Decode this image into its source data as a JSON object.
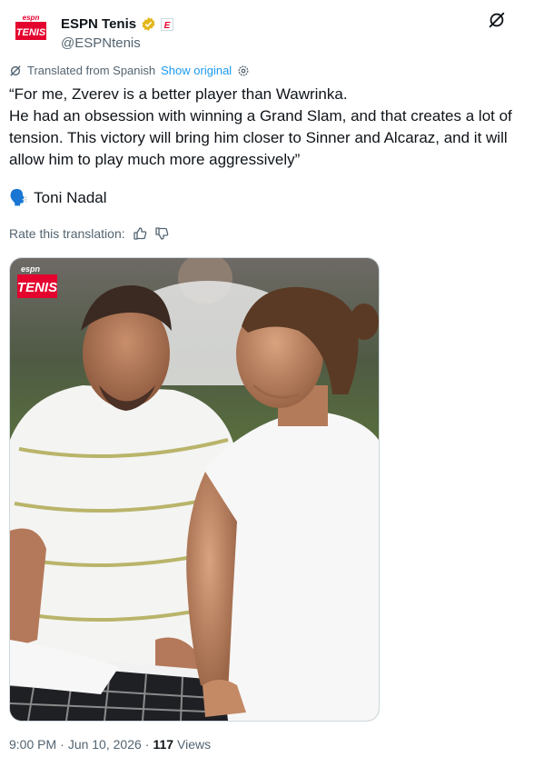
{
  "account": {
    "display_name": "ESPN Tenis",
    "handle": "@ESPNtenis",
    "avatar_text_top": "espn",
    "avatar_text_bottom": "TENIS",
    "affiliate_badge": "E"
  },
  "translation": {
    "label": "Translated from Spanish",
    "show_original": "Show original"
  },
  "tweet": {
    "line1": "“For me, Zverev is a better player than Wawrinka.",
    "line2": "He had an obsession with winning a Grand Slam, and that creates a lot of tension. This victory will bring him closer to Sinner and Alcaraz, and it will allow him to play much more aggressively”",
    "speaker_emoji": "🗣️",
    "speaker": "Toni Nadal"
  },
  "rate": {
    "label": "Rate this translation:"
  },
  "media": {
    "logo_top": "espn",
    "logo_bottom": "TENIS"
  },
  "meta": {
    "time": "9:00 PM",
    "date": "Jun 10, 2026",
    "views_count": "117",
    "views_label": "Views",
    "separator": "·"
  },
  "colors": {
    "accent": "#1d9bf0",
    "espn_red": "#e4032e",
    "gold_badge": "#e2b719",
    "muted": "#536471"
  },
  "icons": {
    "grok": "grok-icon",
    "verified": "verified-gold-icon",
    "gear": "gear-icon",
    "translate": "translate-icon",
    "thumbs_up": "thumbs-up-icon",
    "thumbs_down": "thumbs-down-icon"
  }
}
